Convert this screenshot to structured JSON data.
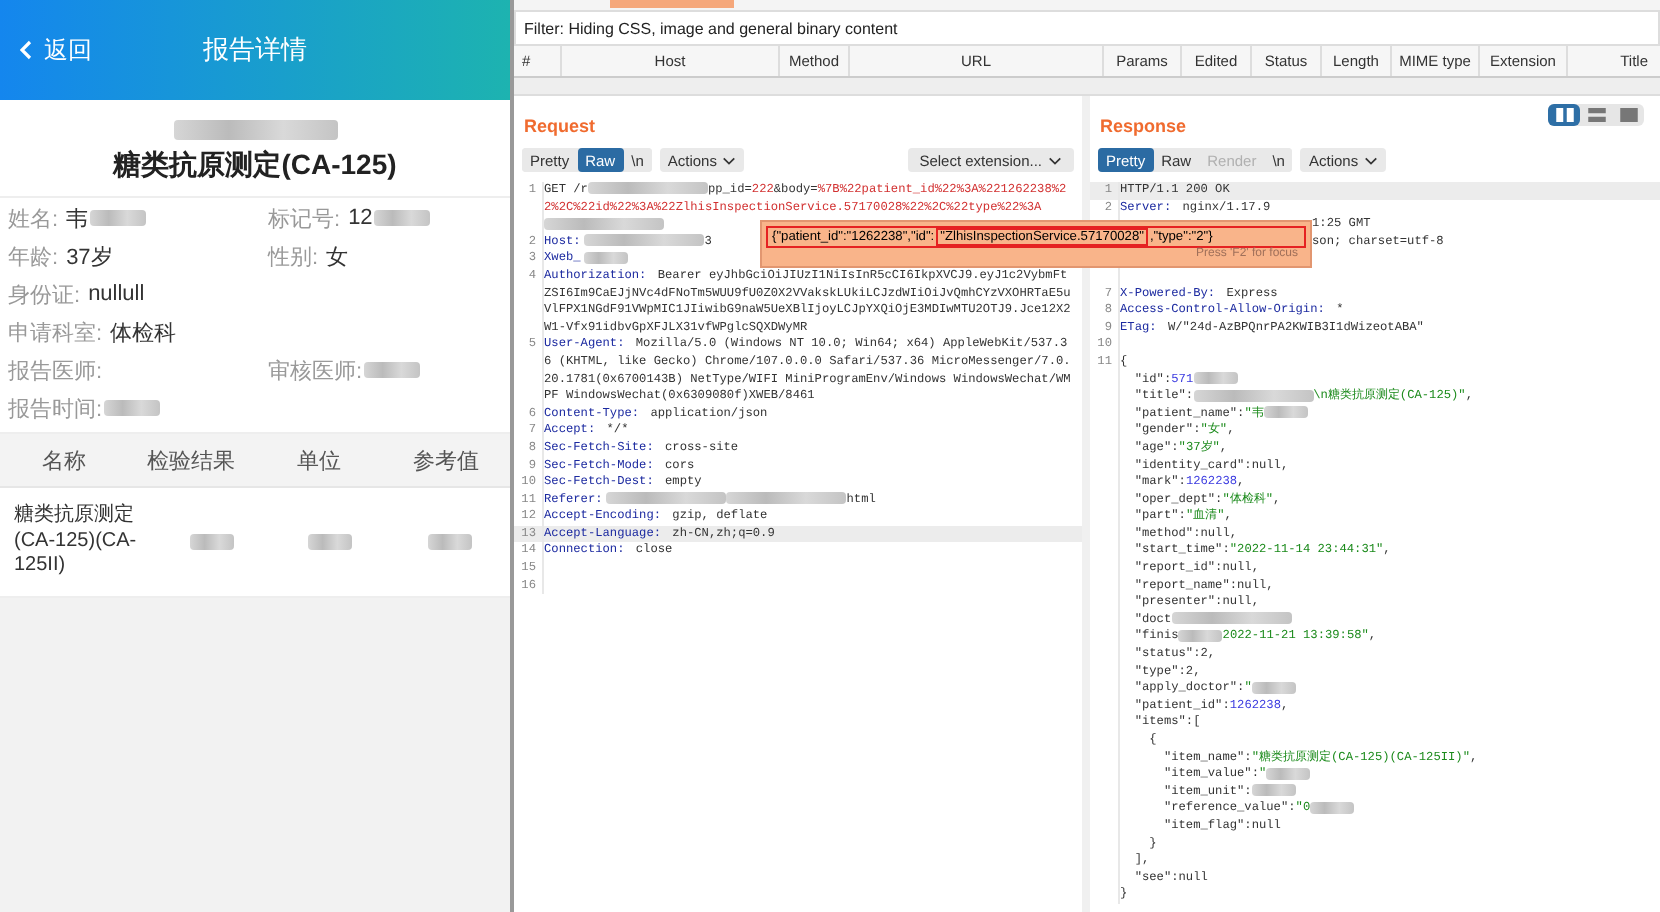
{
  "mobile": {
    "back": "返回",
    "title": "报告详情",
    "report_title": "糖类抗原测定(CA-125)",
    "fields": [
      {
        "label": "姓名:",
        "value": "韦",
        "redacted": true,
        "kind": "half"
      },
      {
        "label": "标记号:",
        "value": "12",
        "redacted": true,
        "kind": "half"
      },
      {
        "label": "年龄:",
        "value": "37岁",
        "redacted": false,
        "kind": "half"
      },
      {
        "label": "性别:",
        "value": "女",
        "redacted": false,
        "kind": "half"
      },
      {
        "label": "身份证:",
        "value": "nullull",
        "redacted": false,
        "kind": "full"
      },
      {
        "label": "申请科室:",
        "value": "体检科",
        "redacted": false,
        "kind": "full"
      },
      {
        "label": "报告医师:",
        "redacted": false,
        "kind": "half"
      },
      {
        "label": "审核医师:",
        "redacted": true,
        "kind": "half"
      },
      {
        "label": "报告时间:",
        "redacted": true,
        "kind": "full"
      }
    ],
    "table": {
      "columns": [
        "名称",
        "检验结果",
        "单位",
        "参考值"
      ],
      "rows": [
        {
          "name": "糖类抗原测定(CA-125)(CA-125II)"
        }
      ]
    }
  },
  "burp": {
    "filter": "Filter: Hiding CSS, image and general binary content",
    "columns": [
      "#",
      "Host",
      "Method",
      "URL",
      "Params",
      "Edited",
      "Status",
      "Length",
      "MIME type",
      "Extension",
      "Title"
    ],
    "request": {
      "title": "Request",
      "tabs": [
        {
          "label": "Pretty",
          "selected": false
        },
        {
          "label": "Raw",
          "selected": true
        },
        {
          "label": "\\n",
          "selected": false
        }
      ],
      "actions": "Actions",
      "extension": "Select extension...",
      "lines": [
        {
          "n": "1",
          "current": false,
          "segs": [
            {
              "kind": "plain",
              "text": "GET /r"
            },
            {
              "kind": "redacted_long"
            },
            {
              "kind": "plain",
              "text": "pp_id="
            },
            {
              "kind": "param",
              "text": "222"
            },
            {
              "kind": "plain",
              "text": "&body="
            },
            {
              "kind": "param",
              "text": "%7B%22patient_id%22%3A%221262238%22%2C%22id%22%3A%22ZlhisInspectionService.57170028%22%2C%22type%22%3A"
            },
            {
              "kind": "redacted_long"
            }
          ]
        },
        {
          "n": "2",
          "current": false,
          "segs": [
            {
              "kind": "key",
              "text": "Host:"
            },
            {
              "kind": "redacted_long"
            },
            {
              "kind": "plain",
              "text": "3"
            }
          ]
        },
        {
          "n": "3",
          "current": false,
          "segs": [
            {
              "kind": "key",
              "text": "Xweb_"
            },
            {
              "kind": "redacted"
            }
          ]
        },
        {
          "n": "4",
          "current": false,
          "segs": [
            {
              "kind": "key",
              "text": "Authorization: "
            },
            {
              "kind": "plain",
              "text": "Bearer eyJhbGciOiJIUzI1NiIsInR5cCI6IkpXVCJ9.eyJ1c2VybmFtZSI6Im9CaEJjNVc4dFNoTm5WUU9fU0Z0X2VVakskLUkiLCJzdWIiOiJvQmhCYzVXOHRTaE5uVlFPX1NGdF91VWpMIC1JIiwibG9naW5UeXBlIjoyLCJpYXQiOjE3MDIwMTU2OTJ9.Jce12X2W1-Vfx91idbvGpXFJLX31vfWPglcSQXDWyMR"
            }
          ]
        },
        {
          "n": "5",
          "current": false,
          "segs": [
            {
              "kind": "key",
              "text": "User-Agent: "
            },
            {
              "kind": "plain",
              "text": "Mozilla/5.0 (Windows NT 10.0; Win64; x64) AppleWebKit/537.36 (KHTML, like Gecko) Chrome/107.0.0.0 Safari/537.36 MicroMessenger/7.0.20.1781(0x6700143B) NetType/WIFI MiniProgramEnv/Windows WindowsWechat/WMPF WindowsWechat(0x6309080f)XWEB/8461"
            }
          ]
        },
        {
          "n": "6",
          "current": false,
          "segs": [
            {
              "kind": "key",
              "text": "Content-Type: "
            },
            {
              "kind": "plain",
              "text": "application/json"
            }
          ]
        },
        {
          "n": "7",
          "current": false,
          "segs": [
            {
              "kind": "key",
              "text": "Accept: "
            },
            {
              "kind": "plain",
              "text": "*/*"
            }
          ]
        },
        {
          "n": "8",
          "current": false,
          "segs": [
            {
              "kind": "key",
              "text": "Sec-Fetch-Site: "
            },
            {
              "kind": "plain",
              "text": "cross-site"
            }
          ]
        },
        {
          "n": "9",
          "current": false,
          "segs": [
            {
              "kind": "key",
              "text": "Sec-Fetch-Mode: "
            },
            {
              "kind": "plain",
              "text": "cors"
            }
          ]
        },
        {
          "n": "10",
          "current": false,
          "segs": [
            {
              "kind": "key",
              "text": "Sec-Fetch-Dest: "
            },
            {
              "kind": "plain",
              "text": "empty"
            }
          ]
        },
        {
          "n": "11",
          "current": false,
          "segs": [
            {
              "kind": "key",
              "text": "Referer:"
            },
            {
              "kind": "redacted_long"
            },
            {
              "kind": "redacted_long"
            },
            {
              "kind": "plain",
              "text": "html"
            }
          ]
        },
        {
          "n": "12",
          "current": false,
          "segs": [
            {
              "kind": "key",
              "text": "Accept-Encoding: "
            },
            {
              "kind": "plain",
              "text": "gzip, deflate"
            }
          ]
        },
        {
          "n": "13",
          "current": true,
          "segs": [
            {
              "kind": "key",
              "text": "Accept-Language: "
            },
            {
              "kind": "plain",
              "text": "zh-CN,zh;q=0.9"
            }
          ]
        },
        {
          "n": "14",
          "current": false,
          "segs": [
            {
              "kind": "key",
              "text": "Connection: "
            },
            {
              "kind": "plain",
              "text": "close"
            }
          ]
        },
        {
          "n": "15",
          "current": false
        },
        {
          "n": "16",
          "current": false
        }
      ]
    },
    "response": {
      "title": "Response",
      "tabs": [
        {
          "label": "Pretty",
          "selected": true,
          "disabled": false
        },
        {
          "label": "Raw",
          "selected": false,
          "disabled": false
        },
        {
          "label": "Render",
          "selected": false,
          "disabled": true
        },
        {
          "label": "\\n",
          "selected": false,
          "disabled": false
        }
      ],
      "actions": "Actions",
      "views": [
        {
          "selected": true
        },
        {
          "selected": false
        },
        {
          "selected": false
        }
      ],
      "lines": [
        {
          "n": "1",
          "segs": [
            {
              "kind": "plain",
              "text": "HTTP/1.1 200 OK"
            }
          ]
        },
        {
          "n": "2",
          "segs": [
            {
              "kind": "key",
              "text": "Server: "
            },
            {
              "kind": "plain",
              "text": "nginx/1.17.9"
            }
          ]
        },
        {
          "segs": [
            {
              "kind": "gap"
            },
            {
              "kind": "plain",
              "text": "1:25 GMT"
            }
          ]
        },
        {
          "segs": [
            {
              "kind": "gap"
            },
            {
              "kind": "plain",
              "text": "son; charset=utf-8"
            }
          ]
        },
        {
          "segs": [
            {
              "kind": "gap"
            }
          ]
        },
        {
          "segs": [
            {
              "kind": "gap"
            }
          ]
        },
        {
          "n": "7",
          "segs": [
            {
              "kind": "key",
              "text": "X-Powered-By: "
            },
            {
              "kind": "plain",
              "text": "Express"
            }
          ]
        },
        {
          "n": "8",
          "segs": [
            {
              "kind": "key",
              "text": "Access-Control-Allow-Origin: "
            },
            {
              "kind": "plain",
              "text": "*"
            }
          ]
        },
        {
          "n": "9",
          "segs": [
            {
              "kind": "key",
              "text": "ETag: "
            },
            {
              "kind": "plain",
              "text": "W/\"24d-AzBPQnrPA2KWIB3I1dWizeotABA\""
            }
          ]
        },
        {
          "n": "10"
        },
        {
          "n": "11",
          "segs": [
            {
              "kind": "plain",
              "text": "{"
            }
          ]
        },
        {
          "segs": [
            {
              "kind": "plain",
              "text": "  \"id\":"
            },
            {
              "kind": "number",
              "text": "571"
            },
            {
              "kind": "redacted"
            }
          ]
        },
        {
          "segs": [
            {
              "kind": "plain",
              "text": "  \"title\":"
            },
            {
              "kind": "redacted_long"
            },
            {
              "kind": "string",
              "text": "\\n糖类抗原测定(CA-125)\""
            },
            {
              "kind": "plain",
              "text": ","
            }
          ]
        },
        {
          "segs": [
            {
              "kind": "plain",
              "text": "  \"patient_name\":"
            },
            {
              "kind": "string",
              "text": "\"韦"
            },
            {
              "kind": "redacted"
            }
          ]
        },
        {
          "segs": [
            {
              "kind": "plain",
              "text": "  \"gender\":"
            },
            {
              "kind": "string",
              "text": "\"女\""
            },
            {
              "kind": "plain",
              "text": ","
            }
          ]
        },
        {
          "segs": [
            {
              "kind": "plain",
              "text": "  \"age\":"
            },
            {
              "kind": "string",
              "text": "\"37岁\""
            },
            {
              "kind": "plain",
              "text": ","
            }
          ]
        },
        {
          "segs": [
            {
              "kind": "plain",
              "text": "  \"identity_card\":null,"
            }
          ]
        },
        {
          "segs": [
            {
              "kind": "plain",
              "text": "  \"mark\":"
            },
            {
              "kind": "number",
              "text": "1262238"
            },
            {
              "kind": "plain",
              "text": ","
            }
          ]
        },
        {
          "segs": [
            {
              "kind": "plain",
              "text": "  \"oper_dept\":"
            },
            {
              "kind": "string",
              "text": "\"体检科\""
            },
            {
              "kind": "plain",
              "text": ","
            }
          ]
        },
        {
          "segs": [
            {
              "kind": "plain",
              "text": "  \"part\":"
            },
            {
              "kind": "string",
              "text": "\"血清\""
            },
            {
              "kind": "plain",
              "text": ","
            }
          ]
        },
        {
          "segs": [
            {
              "kind": "plain",
              "text": "  \"method\":null,"
            }
          ]
        },
        {
          "segs": [
            {
              "kind": "plain",
              "text": "  \"start_time\":"
            },
            {
              "kind": "string",
              "text": "\"2022-11-14 23:44:31\""
            },
            {
              "kind": "plain",
              "text": ","
            }
          ]
        },
        {
          "segs": [
            {
              "kind": "plain",
              "text": "  \"report_id\":null,"
            }
          ]
        },
        {
          "segs": [
            {
              "kind": "plain",
              "text": "  \"report_name\":null,"
            }
          ]
        },
        {
          "segs": [
            {
              "kind": "plain",
              "text": "  \"presenter\":null,"
            }
          ]
        },
        {
          "segs": [
            {
              "kind": "plain",
              "text": "  \"doct"
            },
            {
              "kind": "redacted_long"
            }
          ]
        },
        {
          "segs": [
            {
              "kind": "plain",
              "text": "  \"finis"
            },
            {
              "kind": "redacted"
            },
            {
              "kind": "string",
              "text": "2022-11-21 13:39:58\""
            },
            {
              "kind": "plain",
              "text": ","
            }
          ]
        },
        {
          "segs": [
            {
              "kind": "plain",
              "text": "  \"status\":2,"
            }
          ]
        },
        {
          "segs": [
            {
              "kind": "plain",
              "text": "  \"type\":2,"
            }
          ]
        },
        {
          "segs": [
            {
              "kind": "plain",
              "text": "  \"apply_doctor\":"
            },
            {
              "kind": "string",
              "text": "\""
            },
            {
              "kind": "redacted"
            }
          ]
        },
        {
          "segs": [
            {
              "kind": "plain",
              "text": "  \"patient_id\":"
            },
            {
              "kind": "number",
              "text": "1262238"
            },
            {
              "kind": "plain",
              "text": ","
            }
          ]
        },
        {
          "segs": [
            {
              "kind": "plain",
              "text": "  \"items\":["
            }
          ]
        },
        {
          "segs": [
            {
              "kind": "plain",
              "text": "    {"
            }
          ]
        },
        {
          "segs": [
            {
              "kind": "plain",
              "text": "      \"item_name\":"
            },
            {
              "kind": "string",
              "text": "\"糖类抗原测定(CA-125)(CA-125II)\""
            },
            {
              "kind": "plain",
              "text": ","
            }
          ]
        },
        {
          "segs": [
            {
              "kind": "plain",
              "text": "      \"item_value\":"
            },
            {
              "kind": "string",
              "text": "\""
            },
            {
              "kind": "redacted"
            }
          ]
        },
        {
          "segs": [
            {
              "kind": "plain",
              "text": "      \"item_unit\":"
            },
            {
              "kind": "redacted"
            }
          ]
        },
        {
          "segs": [
            {
              "kind": "plain",
              "text": "      \"reference_value\":"
            },
            {
              "kind": "string",
              "text": "\"0"
            },
            {
              "kind": "redacted"
            }
          ]
        },
        {
          "segs": [
            {
              "kind": "plain",
              "text": "      \"item_flag\":null"
            }
          ]
        },
        {
          "segs": [
            {
              "kind": "plain",
              "text": "    }"
            }
          ]
        },
        {
          "segs": [
            {
              "kind": "plain",
              "text": "  ],"
            }
          ]
        },
        {
          "segs": [
            {
              "kind": "plain",
              "text": "  \"see\":null"
            }
          ]
        },
        {
          "segs": [
            {
              "kind": "plain",
              "text": "}"
            }
          ]
        }
      ]
    },
    "tooltip": {
      "parts": [
        "{\"patient_id\":\"1262238\",\"id\":",
        "\"ZlhisInspectionService.57170028\"",
        ",\"type\":\"2\"}"
      ],
      "hint": "Press 'F2' for focus"
    }
  }
}
